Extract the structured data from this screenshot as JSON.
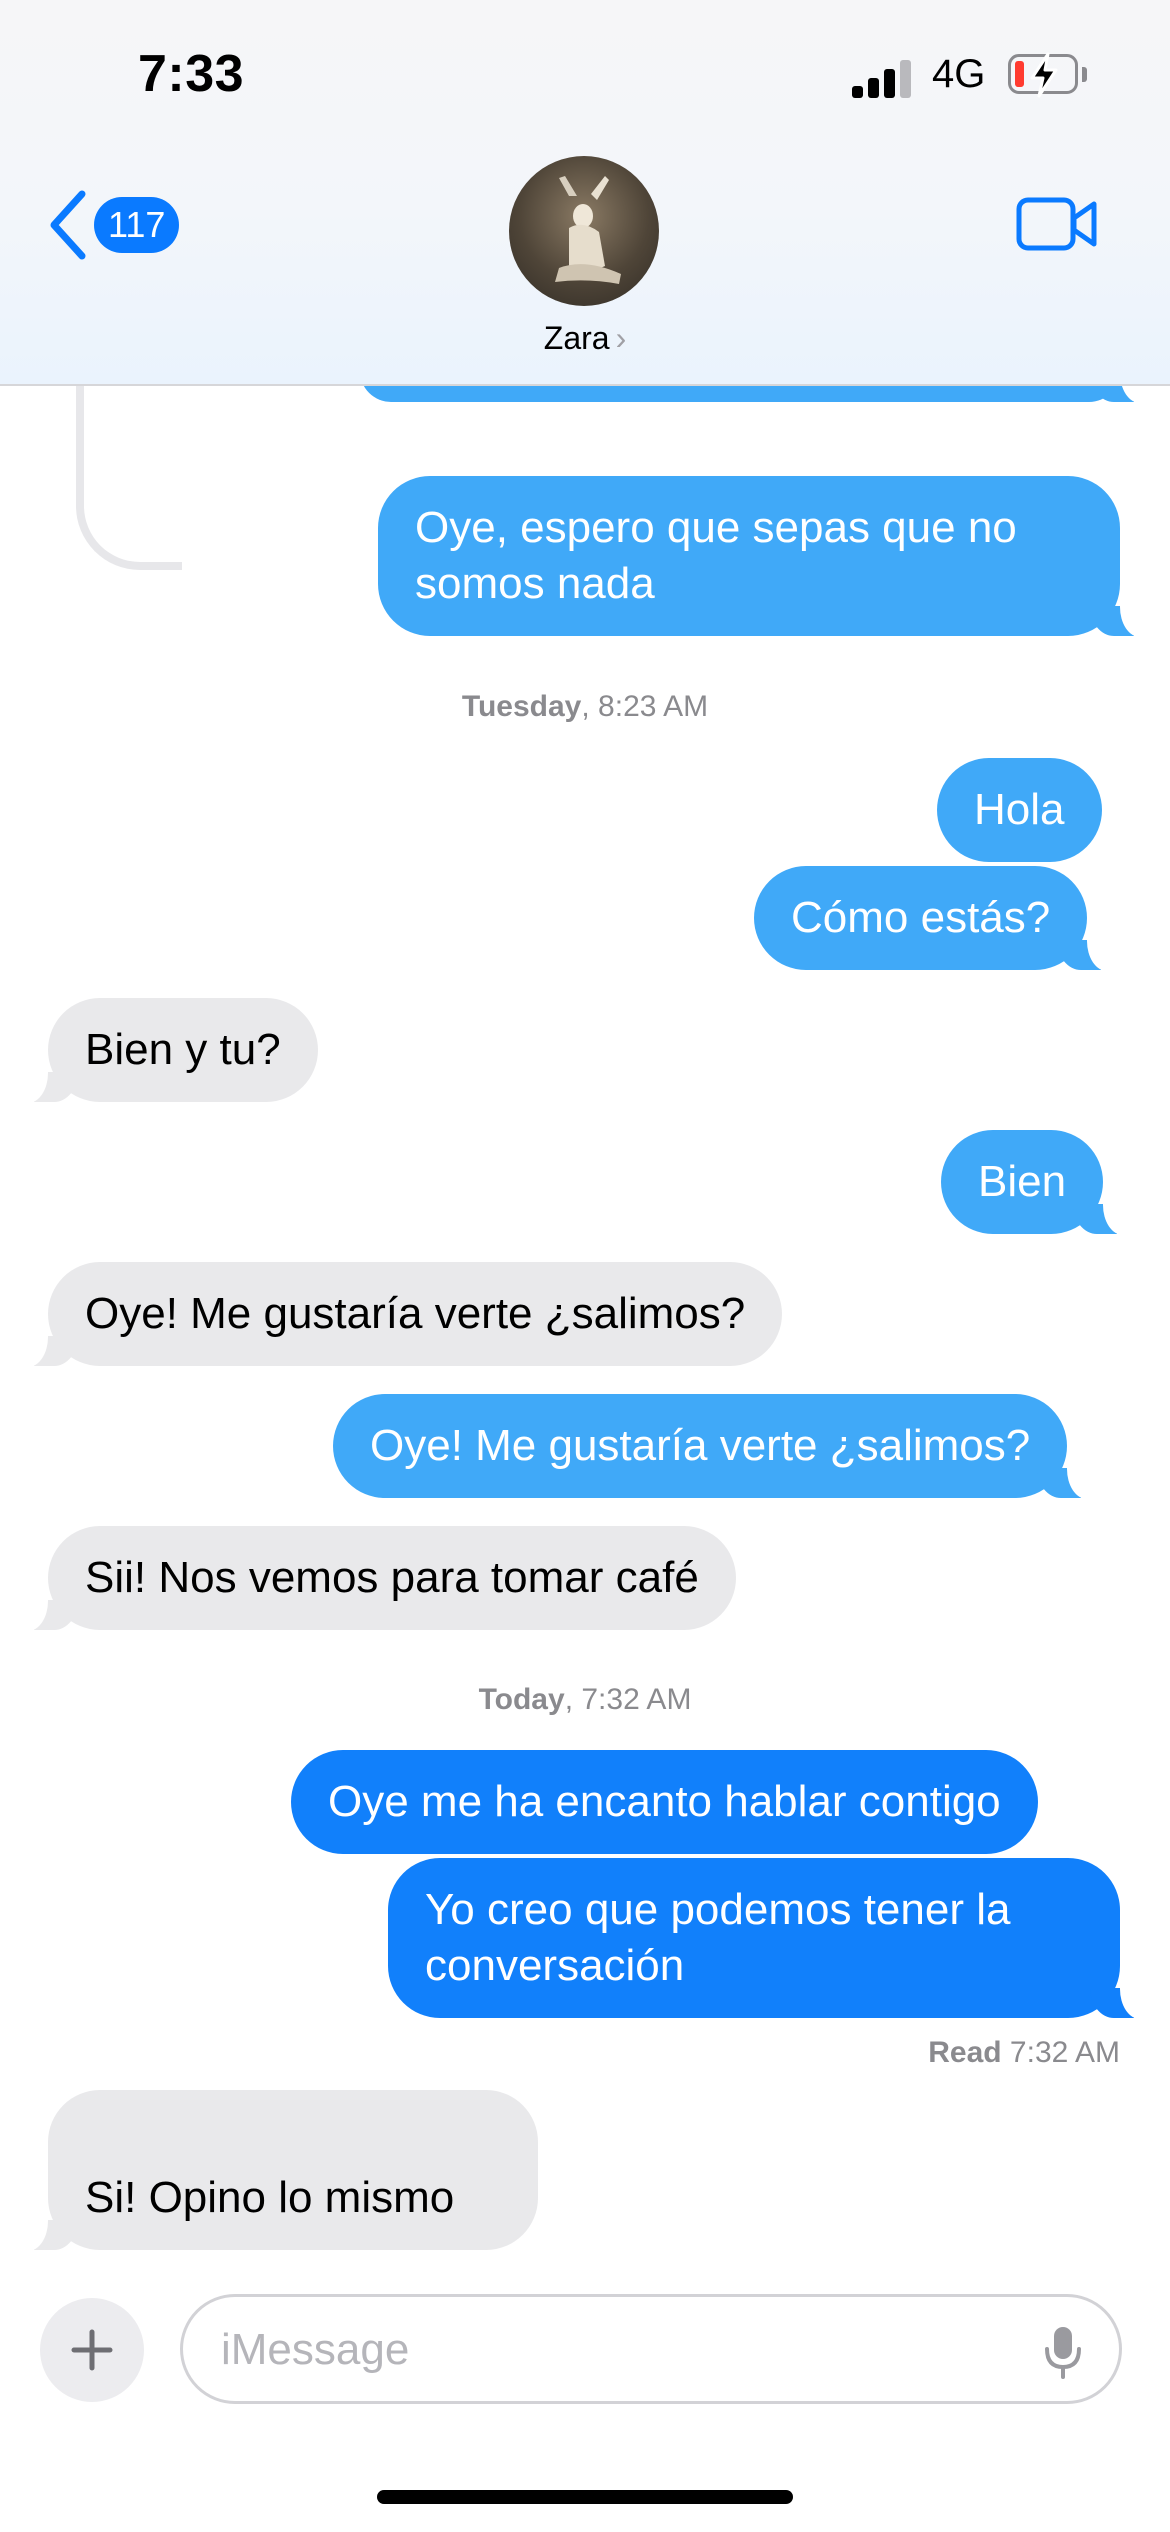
{
  "status_bar": {
    "time": "7:33",
    "network": "4G"
  },
  "header": {
    "back_count": "117",
    "contact_name": "Zara",
    "chevron": "›"
  },
  "messages": [
    {
      "text": "Oye, espero que sepas que no\nsomos nada",
      "side": "sent"
    },
    {
      "text": "Hola",
      "side": "sent"
    },
    {
      "text": "Cómo estás?",
      "side": "sent"
    },
    {
      "text": "Bien y tu?",
      "side": "received"
    },
    {
      "text": "Bien",
      "side": "sent"
    },
    {
      "text": "Oye! Me gustaría verte ¿salimos?",
      "side": "received"
    },
    {
      "text": "Oye! Me gustaría verte ¿salimos?",
      "side": "sent"
    },
    {
      "text": "Sii! Nos vemos para tomar café",
      "side": "received"
    },
    {
      "text": "Oye me ha encanto hablar contigo",
      "side": "sent"
    },
    {
      "text": "Yo creo que podemos tener la\nconversación",
      "side": "sent"
    },
    {
      "text": "Si! Opino lo mismo",
      "side": "received"
    }
  ],
  "timestamps": [
    {
      "day": "Tuesday",
      "time": "8:23 AM"
    },
    {
      "day": "Today",
      "time": "7:32 AM"
    }
  ],
  "read_receipt": {
    "label": "Read",
    "time": "7:32 AM"
  },
  "composer": {
    "placeholder": "iMessage"
  },
  "colors": {
    "accent": "#0a7aff",
    "sent_bubble": "#40a9f8",
    "sent_bubble_latest": "#1180fb",
    "received_bubble": "#e9e9eb",
    "battery_low": "#ff3b30"
  },
  "icons": [
    "back-chevron-icon",
    "video-camera-icon",
    "plus-icon",
    "microphone-icon",
    "signal-icon",
    "battery-charging-icon"
  ]
}
